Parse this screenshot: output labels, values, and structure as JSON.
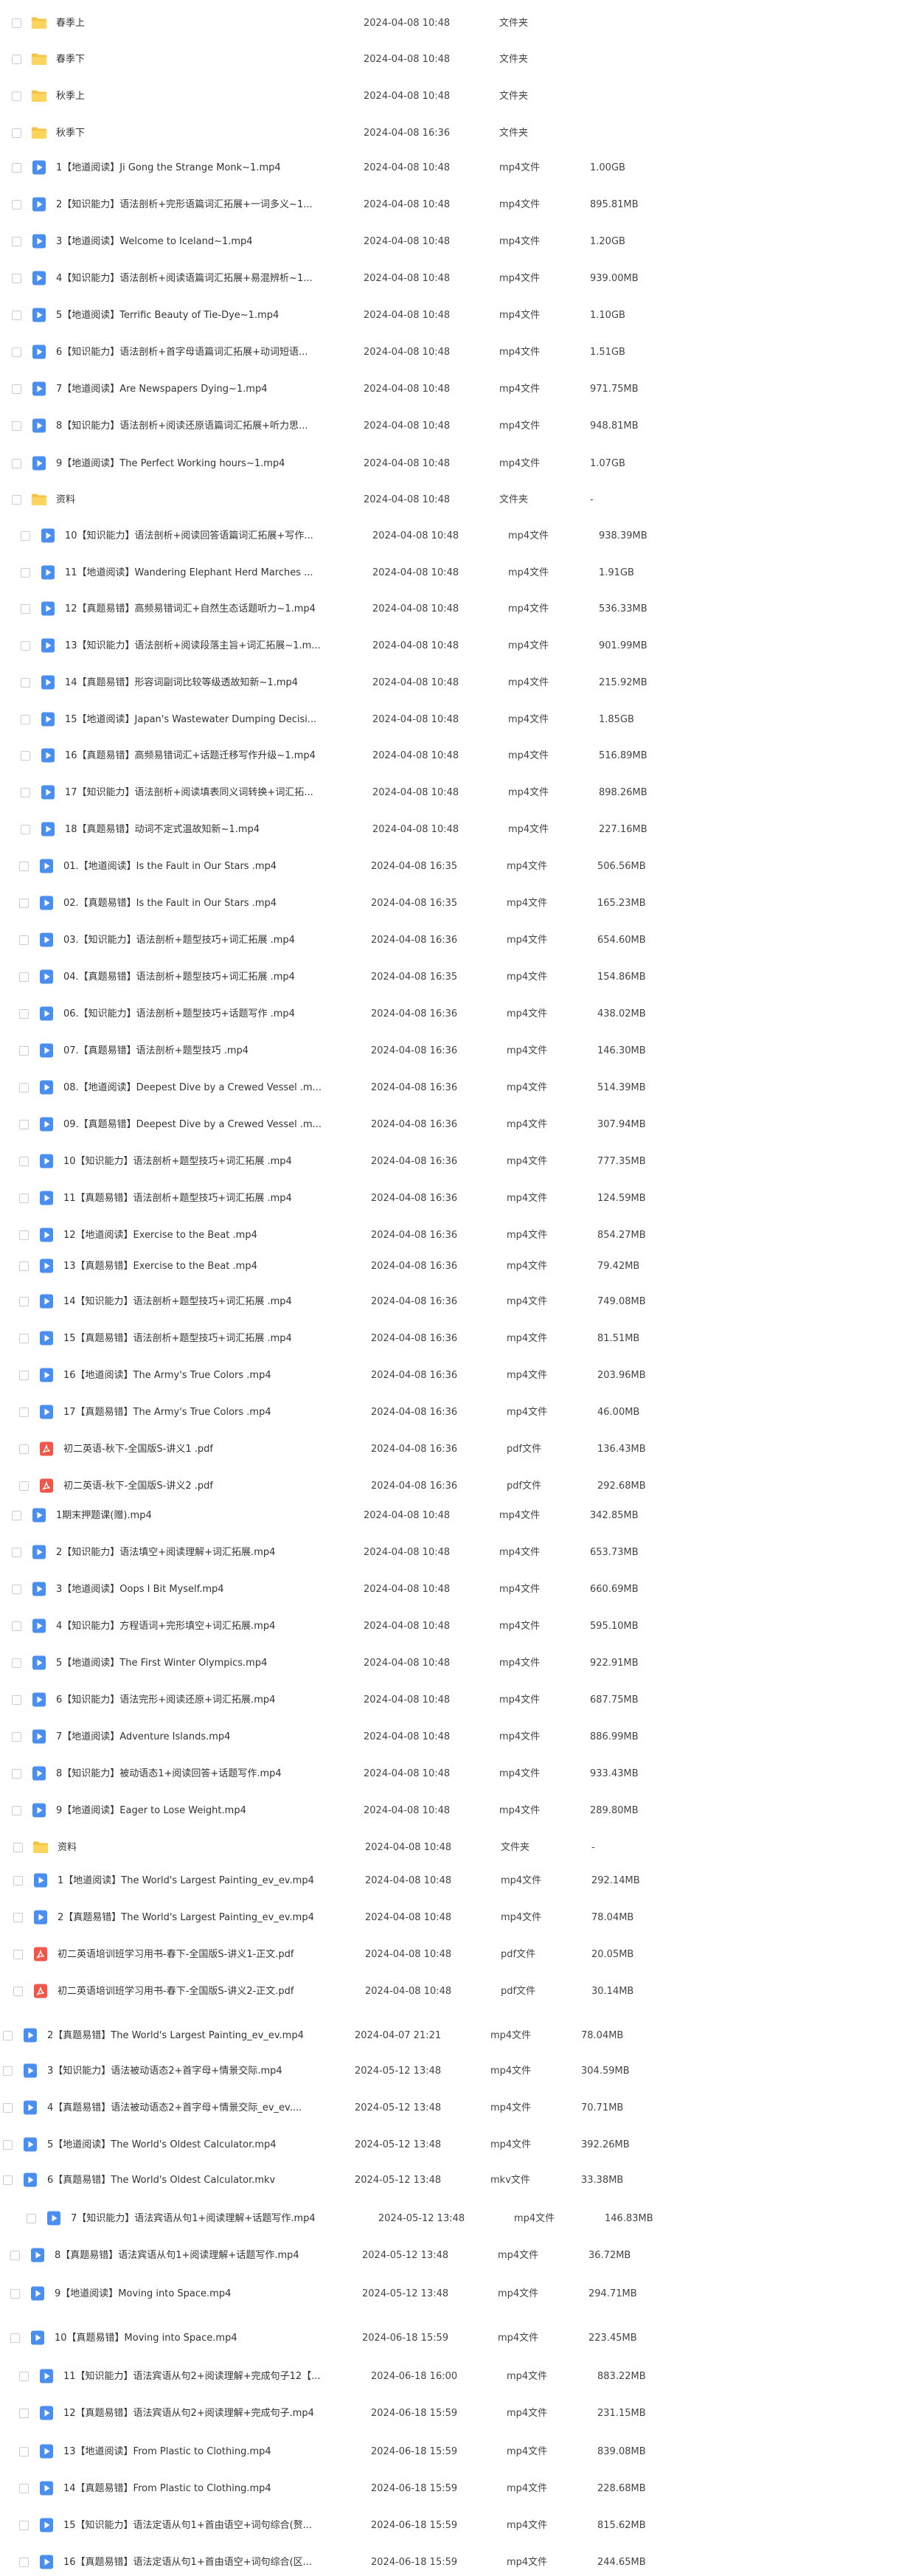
{
  "rows": [
    {
      "name": "春季上",
      "date": "2024-04-08 10:48",
      "type": "文件夹",
      "size": "",
      "icon": "folder"
    },
    {
      "name": "春季下",
      "date": "2024-04-08 10:48",
      "type": "文件夹",
      "size": "",
      "icon": "folder"
    },
    {
      "name": "秋季上",
      "date": "2024-04-08 10:48",
      "type": "文件夹",
      "size": "",
      "icon": "folder"
    },
    {
      "name": "秋季下",
      "date": "2024-04-08 16:36",
      "type": "文件夹",
      "size": "",
      "icon": "folder"
    },
    {
      "name": "1【地道阅读】Ji Gong the Strange Monk~1.mp4",
      "date": "2024-04-08 10:48",
      "type": "mp4文件",
      "size": "1.00GB",
      "icon": "video"
    },
    {
      "name": "2【知识能力】语法剖析+完形语篇词汇拓展+一词多义~1...",
      "date": "2024-04-08 10:48",
      "type": "mp4文件",
      "size": "895.81MB",
      "icon": "video"
    },
    {
      "name": "3【地道阅读】Welcome to Iceland~1.mp4",
      "date": "2024-04-08 10:48",
      "type": "mp4文件",
      "size": "1.20GB",
      "icon": "video"
    },
    {
      "name": "4【知识能力】语法剖析+阅读语篇词汇拓展+易混辨析~1...",
      "date": "2024-04-08 10:48",
      "type": "mp4文件",
      "size": "939.00MB",
      "icon": "video"
    },
    {
      "name": "5【地道阅读】Terrific Beauty of Tie-Dye~1.mp4",
      "date": "2024-04-08 10:48",
      "type": "mp4文件",
      "size": "1.10GB",
      "icon": "video"
    },
    {
      "name": "6【知识能力】语法剖析+首字母语篇词汇拓展+动词短语...",
      "date": "2024-04-08 10:48",
      "type": "mp4文件",
      "size": "1.51GB",
      "icon": "video"
    },
    {
      "name": "7【地道阅读】Are Newspapers Dying~1.mp4",
      "date": "2024-04-08 10:48",
      "type": "mp4文件",
      "size": "971.75MB",
      "icon": "video"
    },
    {
      "name": "8【知识能力】语法剖析+阅读还原语篇词汇拓展+听力思...",
      "date": "2024-04-08 10:48",
      "type": "mp4文件",
      "size": "948.81MB",
      "icon": "video"
    },
    {
      "name": "9【地道阅读】The Perfect Working hours~1.mp4",
      "date": "2024-04-08 10:48",
      "type": "mp4文件",
      "size": "1.07GB",
      "icon": "video"
    },
    {
      "name": "资料",
      "date": "2024-04-08 10:48",
      "type": "文件夹",
      "size": "-",
      "icon": "folder"
    },
    {
      "name": "10【知识能力】语法剖析+阅读回答语篇词汇拓展+写作...",
      "date": "2024-04-08 10:48",
      "type": "mp4文件",
      "size": "938.39MB",
      "icon": "video"
    },
    {
      "name": "11【地道阅读】Wandering Elephant Herd Marches ...",
      "date": "2024-04-08 10:48",
      "type": "mp4文件",
      "size": "1.91GB",
      "icon": "video"
    },
    {
      "name": "12【真题易错】高频易错词汇+自然生态话题听力~1.mp4",
      "date": "2024-04-08 10:48",
      "type": "mp4文件",
      "size": "536.33MB",
      "icon": "video"
    },
    {
      "name": "13【知识能力】语法剖析+阅读段落主旨+词汇拓展~1.m...",
      "date": "2024-04-08 10:48",
      "type": "mp4文件",
      "size": "901.99MB",
      "icon": "video"
    },
    {
      "name": "14【真题易错】形容词副词比较等级透故知新~1.mp4",
      "date": "2024-04-08 10:48",
      "type": "mp4文件",
      "size": "215.92MB",
      "icon": "video"
    },
    {
      "name": "15【地道阅读】Japan's Wastewater Dumping Decisi...",
      "date": "2024-04-08 10:48",
      "type": "mp4文件",
      "size": "1.85GB",
      "icon": "video"
    },
    {
      "name": "16【真题易错】高频易错词汇+话题迁移写作升级~1.mp4",
      "date": "2024-04-08 10:48",
      "type": "mp4文件",
      "size": "516.89MB",
      "icon": "video"
    },
    {
      "name": "17【知识能力】语法剖析+阅读填表同义词转换+词汇拓...",
      "date": "2024-04-08 10:48",
      "type": "mp4文件",
      "size": "898.26MB",
      "icon": "video"
    },
    {
      "name": "18【真题易错】动词不定式温故知新~1.mp4",
      "date": "2024-04-08 10:48",
      "type": "mp4文件",
      "size": "227.16MB",
      "icon": "video"
    },
    {
      "name": "01.【地道阅读】Is the Fault in Our Stars .mp4",
      "date": "2024-04-08 16:35",
      "type": "mp4文件",
      "size": "506.56MB",
      "icon": "video"
    },
    {
      "name": "02.【真题易错】Is the Fault in Our Stars .mp4",
      "date": "2024-04-08 16:35",
      "type": "mp4文件",
      "size": "165.23MB",
      "icon": "video"
    },
    {
      "name": "03.【知识能力】语法剖析+题型技巧+词汇拓展 .mp4",
      "date": "2024-04-08 16:36",
      "type": "mp4文件",
      "size": "654.60MB",
      "icon": "video"
    },
    {
      "name": "04.【真题易错】语法剖析+题型技巧+词汇拓展 .mp4",
      "date": "2024-04-08 16:35",
      "type": "mp4文件",
      "size": "154.86MB",
      "icon": "video"
    },
    {
      "name": "06.【知识能力】语法剖析+题型技巧+话题写作 .mp4",
      "date": "2024-04-08 16:36",
      "type": "mp4文件",
      "size": "438.02MB",
      "icon": "video"
    },
    {
      "name": "07.【真题易错】语法剖析+题型技巧 .mp4",
      "date": "2024-04-08 16:36",
      "type": "mp4文件",
      "size": "146.30MB",
      "icon": "video"
    },
    {
      "name": "08.【地道阅读】Deepest Dive by a Crewed Vessel .m...",
      "date": "2024-04-08 16:36",
      "type": "mp4文件",
      "size": "514.39MB",
      "icon": "video"
    },
    {
      "name": "09.【真题易错】Deepest Dive by a Crewed Vessel .m...",
      "date": "2024-04-08 16:36",
      "type": "mp4文件",
      "size": "307.94MB",
      "icon": "video"
    },
    {
      "name": "10【知识能力】语法剖析+题型技巧+词汇拓展 .mp4",
      "date": "2024-04-08 16:36",
      "type": "mp4文件",
      "size": "777.35MB",
      "icon": "video"
    },
    {
      "name": "11【真题易错】语法剖析+题型技巧+词汇拓展 .mp4",
      "date": "2024-04-08 16:36",
      "type": "mp4文件",
      "size": "124.59MB",
      "icon": "video"
    },
    {
      "name": "12【地道阅读】Exercise to the Beat .mp4",
      "date": "2024-04-08 16:36",
      "type": "mp4文件",
      "size": "854.27MB",
      "icon": "video"
    },
    {
      "name": "13【真题易错】Exercise to the Beat .mp4",
      "date": "2024-04-08 16:36",
      "type": "mp4文件",
      "size": "79.42MB",
      "icon": "video"
    },
    {
      "name": "14【知识能力】语法剖析+题型技巧+词汇拓展 .mp4",
      "date": "2024-04-08 16:36",
      "type": "mp4文件",
      "size": "749.08MB",
      "icon": "video"
    },
    {
      "name": "15【真题易错】语法剖析+题型技巧+词汇拓展 .mp4",
      "date": "2024-04-08 16:36",
      "type": "mp4文件",
      "size": "81.51MB",
      "icon": "video"
    },
    {
      "name": "16【地道阅读】The Army's True Colors .mp4",
      "date": "2024-04-08 16:36",
      "type": "mp4文件",
      "size": "203.96MB",
      "icon": "video"
    },
    {
      "name": "17【真题易错】The Army's True Colors .mp4",
      "date": "2024-04-08 16:36",
      "type": "mp4文件",
      "size": "46.00MB",
      "icon": "video"
    },
    {
      "name": "初二英语-秋下-全国版S-讲义1 .pdf",
      "date": "2024-04-08 16:36",
      "type": "pdf文件",
      "size": "136.43MB",
      "icon": "pdf"
    },
    {
      "name": "初二英语-秋下-全国版S-讲义2 .pdf",
      "date": "2024-04-08 16:36",
      "type": "pdf文件",
      "size": "292.68MB",
      "icon": "pdf"
    },
    {
      "name": "1期末押题课(赠).mp4",
      "date": "2024-04-08 10:48",
      "type": "mp4文件",
      "size": "342.85MB",
      "icon": "video"
    },
    {
      "name": "2【知识能力】语法填空+阅读理解+词汇拓展.mp4",
      "date": "2024-04-08 10:48",
      "type": "mp4文件",
      "size": "653.73MB",
      "icon": "video"
    },
    {
      "name": "3【地道阅读】Oops I Bit Myself.mp4",
      "date": "2024-04-08 10:48",
      "type": "mp4文件",
      "size": "660.69MB",
      "icon": "video"
    },
    {
      "name": "4【知识能力】方程语词+完形填空+词汇拓展.mp4",
      "date": "2024-04-08 10:48",
      "type": "mp4文件",
      "size": "595.10MB",
      "icon": "video"
    },
    {
      "name": "5【地道阅读】The First Winter Olympics.mp4",
      "date": "2024-04-08 10:48",
      "type": "mp4文件",
      "size": "922.91MB",
      "icon": "video"
    },
    {
      "name": "6【知识能力】语法完形+阅读还原+词汇拓展.mp4",
      "date": "2024-04-08 10:48",
      "type": "mp4文件",
      "size": "687.75MB",
      "icon": "video"
    },
    {
      "name": "7【地道阅读】Adventure Islands.mp4",
      "date": "2024-04-08 10:48",
      "type": "mp4文件",
      "size": "886.99MB",
      "icon": "video"
    },
    {
      "name": "8【知识能力】被动语态1+阅读回答+话题写作.mp4",
      "date": "2024-04-08 10:48",
      "type": "mp4文件",
      "size": "933.43MB",
      "icon": "video"
    },
    {
      "name": "9【地道阅读】Eager to Lose Weight.mp4",
      "date": "2024-04-08 10:48",
      "type": "mp4文件",
      "size": "289.80MB",
      "icon": "video"
    },
    {
      "name": "资料",
      "date": "2024-04-08 10:48",
      "type": "文件夹",
      "size": "-",
      "icon": "folder"
    },
    {
      "name": "1【地道阅读】The World's Largest Painting_ev_ev.mp4",
      "date": "2024-04-08 10:48",
      "type": "mp4文件",
      "size": "292.14MB",
      "icon": "video"
    },
    {
      "name": "2【真题易错】The World's Largest Painting_ev_ev.mp4",
      "date": "2024-04-08 10:48",
      "type": "mp4文件",
      "size": "78.04MB",
      "icon": "video"
    },
    {
      "name": "初二英语培训班学习用书-春下-全国版S-讲义1-正文.pdf",
      "date": "2024-04-08 10:48",
      "type": "pdf文件",
      "size": "20.05MB",
      "icon": "pdf"
    },
    {
      "name": "初二英语培训班学习用书-春下-全国版S-讲义2-正文.pdf",
      "date": "2024-04-08 10:48",
      "type": "pdf文件",
      "size": "30.14MB",
      "icon": "pdf"
    },
    {
      "name": "2【真题易错】The World's Largest Painting_ev_ev.mp4",
      "date": "2024-04-07 21:21",
      "type": "mp4文件",
      "size": "78.04MB",
      "icon": "video"
    },
    {
      "name": "3【知识能力】语法被动语态2+首字母+情景交际.mp4",
      "date": "2024-05-12 13:48",
      "type": "mp4文件",
      "size": "304.59MB",
      "icon": "video"
    },
    {
      "name": "4【真题易错】语法被动语态2+首字母+情景交际_ev_ev....",
      "date": "2024-05-12 13:48",
      "type": "mp4文件",
      "size": "70.71MB",
      "icon": "video"
    },
    {
      "name": "5【地道阅读】The World's Oldest Calculator.mp4",
      "date": "2024-05-12 13:48",
      "type": "mp4文件",
      "size": "392.26MB",
      "icon": "video"
    },
    {
      "name": "6【真题易错】The World's Oldest Calculator.mkv",
      "date": "2024-05-12 13:48",
      "type": "mkv文件",
      "size": "33.38MB",
      "icon": "video"
    },
    {
      "name": "7【知识能力】语法宾语从句1+阅读理解+话题写作.mp4",
      "date": "2024-05-12 13:48",
      "type": "mp4文件",
      "size": "146.83MB",
      "icon": "video"
    },
    {
      "name": "8【真题易错】语法宾语从句1+阅读理解+话题写作.mp4",
      "date": "2024-05-12 13:48",
      "type": "mp4文件",
      "size": "36.72MB",
      "icon": "video"
    },
    {
      "name": "9【地道阅读】Moving into Space.mp4",
      "date": "2024-05-12 13:48",
      "type": "mp4文件",
      "size": "294.71MB",
      "icon": "video"
    },
    {
      "name": "10【真题易错】Moving into Space.mp4",
      "date": "2024-06-18 15:59",
      "type": "mp4文件",
      "size": "223.45MB",
      "icon": "video"
    },
    {
      "name": "11【知识能力】语法宾语从句2+阅读理解+完成句子12【...",
      "date": "2024-06-18 16:00",
      "type": "mp4文件",
      "size": "883.22MB",
      "icon": "video"
    },
    {
      "name": "12【真题易错】语法宾语从句2+阅读理解+完成句子.mp4",
      "date": "2024-06-18 15:59",
      "type": "mp4文件",
      "size": "231.15MB",
      "icon": "video"
    },
    {
      "name": "13【地道阅读】From Plastic to Clothing.mp4",
      "date": "2024-06-18 15:59",
      "type": "mp4文件",
      "size": "839.08MB",
      "icon": "video"
    },
    {
      "name": "14【真题易错】From Plastic to Clothing.mp4",
      "date": "2024-06-18 15:59",
      "type": "mp4文件",
      "size": "228.68MB",
      "icon": "video"
    },
    {
      "name": "15【知识能力】语法定语从句1+首由语空+词句综合(赘...",
      "date": "2024-06-18 15:59",
      "type": "mp4文件",
      "size": "815.62MB",
      "icon": "video"
    },
    {
      "name": "16【真题易错】语法定语从句1+首由语空+词句综合(区...",
      "date": "2024-06-18 15:59",
      "type": "mp4文件",
      "size": "244.65MB",
      "icon": "video"
    }
  ]
}
